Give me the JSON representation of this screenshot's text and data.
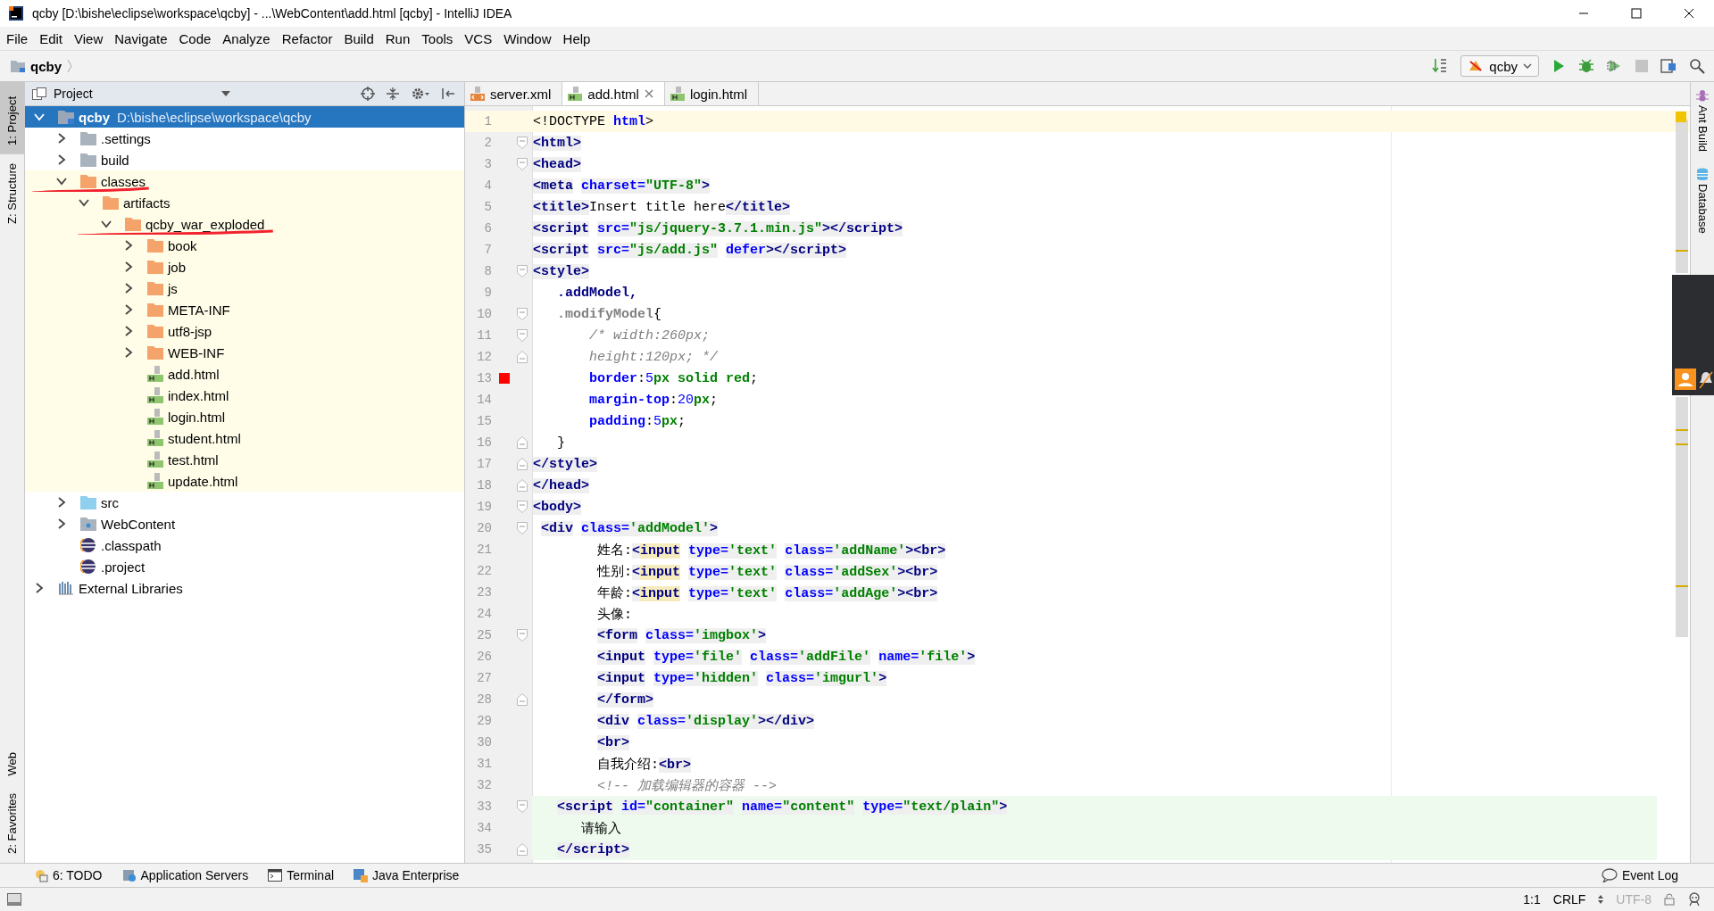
{
  "window": {
    "title": "qcby [D:\\bishe\\eclipse\\workspace\\qcby] - ...\\WebContent\\add.html [qcby] - IntelliJ IDEA"
  },
  "menu": [
    "File",
    "Edit",
    "View",
    "Navigate",
    "Code",
    "Analyze",
    "Refactor",
    "Build",
    "Run",
    "Tools",
    "VCS",
    "Window",
    "Help"
  ],
  "navbar": {
    "crumb": "qcby",
    "run_config": "qcby"
  },
  "left_stripe": {
    "top": [
      {
        "label": "1: Project",
        "selected": true
      },
      {
        "label": "Z: Structure",
        "selected": false
      }
    ],
    "bottom": [
      {
        "label": "Web",
        "selected": false
      },
      {
        "label": "2: Favorites",
        "selected": false
      }
    ]
  },
  "right_stripe": [
    {
      "label": "Ant Build",
      "kind": "ant"
    },
    {
      "label": "Database",
      "kind": "db"
    }
  ],
  "project": {
    "title": "Project",
    "tree": [
      {
        "name": "qcby",
        "path": "D:\\bishe\\eclipse\\workspace\\qcby",
        "kind": "module",
        "expanded": true,
        "selected": true,
        "children": [
          {
            "name": ".settings",
            "kind": "folder",
            "expanded": false,
            "selected": false,
            "excluded": false,
            "annotated": false
          },
          {
            "name": "build",
            "kind": "folder",
            "expanded": false,
            "selected": false,
            "excluded": false,
            "annotated": false
          },
          {
            "name": "classes",
            "kind": "folder-excluded",
            "expanded": true,
            "selected": false,
            "excluded": true,
            "annotated": true,
            "children": [
              {
                "name": "artifacts",
                "kind": "folder-excluded",
                "expanded": true,
                "selected": false,
                "children": [
                  {
                    "name": "qcby_war_exploded",
                    "kind": "folder-excluded",
                    "expanded": true,
                    "selected": false,
                    "annotated": true,
                    "children": [
                      {
                        "name": "book",
                        "kind": "folder-excluded",
                        "expanded": false,
                        "selected": false
                      },
                      {
                        "name": "job",
                        "kind": "folder-excluded",
                        "expanded": false,
                        "selected": false
                      },
                      {
                        "name": "js",
                        "kind": "folder-excluded",
                        "expanded": false,
                        "selected": false
                      },
                      {
                        "name": "META-INF",
                        "kind": "folder-excluded",
                        "expanded": false,
                        "selected": false
                      },
                      {
                        "name": "utf8-jsp",
                        "kind": "folder-excluded",
                        "expanded": false,
                        "selected": false
                      },
                      {
                        "name": "WEB-INF",
                        "kind": "folder-excluded",
                        "expanded": false,
                        "selected": false
                      },
                      {
                        "name": "add.html",
                        "kind": "html",
                        "selected": false
                      },
                      {
                        "name": "index.html",
                        "kind": "html",
                        "selected": false
                      },
                      {
                        "name": "login.html",
                        "kind": "html",
                        "selected": false
                      },
                      {
                        "name": "student.html",
                        "kind": "html",
                        "selected": false
                      },
                      {
                        "name": "test.html",
                        "kind": "html",
                        "selected": false
                      },
                      {
                        "name": "update.html",
                        "kind": "html",
                        "selected": false
                      }
                    ]
                  }
                ]
              }
            ]
          },
          {
            "name": "src",
            "kind": "folder-source",
            "expanded": false,
            "selected": false,
            "excluded": false,
            "annotated": false
          },
          {
            "name": "WebContent",
            "kind": "folder-web",
            "expanded": false,
            "selected": false,
            "excluded": false,
            "annotated": false
          },
          {
            "name": ".classpath",
            "kind": "eclipse",
            "selected": false,
            "excluded": false,
            "annotated": false
          },
          {
            "name": ".project",
            "kind": "eclipse",
            "selected": false,
            "excluded": false,
            "annotated": false
          }
        ]
      },
      {
        "name": "External Libraries",
        "kind": "library",
        "expanded": false,
        "selected": false
      }
    ]
  },
  "tabs": [
    {
      "label": "server.xml",
      "kind": "xml",
      "selected": false
    },
    {
      "label": "add.html",
      "kind": "html",
      "selected": true
    },
    {
      "label": "login.html",
      "kind": "html",
      "selected": false
    }
  ],
  "editor": {
    "lines": [
      {
        "num": "1",
        "current": true,
        "tokens": [
          {
            "kind": "text",
            "text": "<!DOCTYPE "
          },
          {
            "kind": "keyword",
            "text": "html"
          },
          {
            "kind": "text",
            "text": ">"
          }
        ]
      },
      {
        "num": "2",
        "fold_start": true,
        "tokens": [
          {
            "kind": "tag",
            "text": "<html>"
          }
        ]
      },
      {
        "num": "3",
        "fold_start": true,
        "tokens": [
          {
            "kind": "tag",
            "text": "<head>"
          }
        ]
      },
      {
        "num": "4",
        "tokens": [
          {
            "kind": "tag",
            "text": "<meta"
          },
          {
            "kind": "attr",
            "text": " charset="
          },
          {
            "kind": "value",
            "text": "\"UTF-8\""
          },
          {
            "kind": "tag",
            "text": ">"
          }
        ]
      },
      {
        "num": "5",
        "tokens": [
          {
            "kind": "tag",
            "text": "<title>"
          },
          {
            "kind": "text",
            "text": "Insert title here"
          },
          {
            "kind": "tag",
            "text": "</title>"
          }
        ]
      },
      {
        "num": "6",
        "tokens": [
          {
            "kind": "tag",
            "text": "<script"
          },
          {
            "kind": "attr",
            "text": " src="
          },
          {
            "kind": "value",
            "text": "\"js/jquery-3.7.1.min.js\""
          },
          {
            "kind": "tag",
            "text": "></script>"
          }
        ]
      },
      {
        "num": "7",
        "tokens": [
          {
            "kind": "tag",
            "text": "<script"
          },
          {
            "kind": "attr",
            "text": " src="
          },
          {
            "kind": "value",
            "text": "\"js/add.js\""
          },
          {
            "kind": "attr",
            "text": " defer"
          },
          {
            "kind": "tag",
            "text": "></script>"
          }
        ]
      },
      {
        "num": "8",
        "fold_start": true,
        "tokens": [
          {
            "kind": "tag",
            "text": "<style>"
          }
        ]
      },
      {
        "num": "9",
        "tokens": [
          {
            "kind": "selector",
            "text": "   .addModel,"
          }
        ]
      },
      {
        "num": "10",
        "fold_start": true,
        "tokens": [
          {
            "kind": "unused",
            "text": "   .modifyModel"
          },
          {
            "kind": "text",
            "text": "{"
          }
        ]
      },
      {
        "num": "11",
        "fold_start": true,
        "tokens": [
          {
            "kind": "comment",
            "text": "       /* width:260px;"
          }
        ]
      },
      {
        "num": "12",
        "fold_end": true,
        "tokens": [
          {
            "kind": "comment",
            "text": "       height:120px; */"
          }
        ]
      },
      {
        "num": "13",
        "color": "#ff0000",
        "tokens": [
          {
            "kind": "property",
            "text": "       border"
          },
          {
            "kind": "text",
            "text": ":"
          },
          {
            "kind": "number",
            "text": "5"
          },
          {
            "kind": "cssvalue",
            "text": "px solid red"
          },
          {
            "kind": "text",
            "text": ";"
          }
        ]
      },
      {
        "num": "14",
        "tokens": [
          {
            "kind": "property",
            "text": "       margin-top"
          },
          {
            "kind": "text",
            "text": ":"
          },
          {
            "kind": "number",
            "text": "20"
          },
          {
            "kind": "cssvalue",
            "text": "px"
          },
          {
            "kind": "text",
            "text": ";"
          }
        ]
      },
      {
        "num": "15",
        "tokens": [
          {
            "kind": "property",
            "text": "       padding"
          },
          {
            "kind": "text",
            "text": ":"
          },
          {
            "kind": "number",
            "text": "5"
          },
          {
            "kind": "cssvalue",
            "text": "px"
          },
          {
            "kind": "text",
            "text": ";"
          }
        ]
      },
      {
        "num": "16",
        "fold_end": true,
        "tokens": [
          {
            "kind": "text",
            "text": "   }"
          }
        ]
      },
      {
        "num": "17",
        "fold_end": true,
        "tokens": [
          {
            "kind": "tag",
            "text": "</style>"
          }
        ]
      },
      {
        "num": "18",
        "fold_end": true,
        "tokens": [
          {
            "kind": "tag",
            "text": "</head>"
          }
        ]
      },
      {
        "num": "19",
        "fold_start": true,
        "tokens": [
          {
            "kind": "tag",
            "text": "<body>"
          }
        ]
      },
      {
        "num": "20",
        "fold_start": true,
        "tokens": [
          {
            "kind": "tag",
            "text": " <div"
          },
          {
            "kind": "attr",
            "text": " class="
          },
          {
            "kind": "value",
            "text": "'addModel'"
          },
          {
            "kind": "tag",
            "text": ">"
          }
        ]
      },
      {
        "num": "21",
        "tokens": [
          {
            "kind": "text",
            "text": "        姓名:"
          },
          {
            "kind": "tag",
            "text": "<"
          },
          {
            "kind": "match",
            "text": "input"
          },
          {
            "kind": "attr",
            "text": " type="
          },
          {
            "kind": "value",
            "text": "'text'"
          },
          {
            "kind": "attr",
            "text": " class="
          },
          {
            "kind": "value",
            "text": "'addName'"
          },
          {
            "kind": "tag",
            "text": "><br>"
          }
        ]
      },
      {
        "num": "22",
        "tokens": [
          {
            "kind": "text",
            "text": "        性别:"
          },
          {
            "kind": "tag",
            "text": "<"
          },
          {
            "kind": "match",
            "text": "input"
          },
          {
            "kind": "attr",
            "text": " type="
          },
          {
            "kind": "value",
            "text": "'text'"
          },
          {
            "kind": "attr",
            "text": " class="
          },
          {
            "kind": "value",
            "text": "'addSex'"
          },
          {
            "kind": "tag",
            "text": "><br>"
          }
        ]
      },
      {
        "num": "23",
        "tokens": [
          {
            "kind": "text",
            "text": "        年龄:"
          },
          {
            "kind": "tag",
            "text": "<"
          },
          {
            "kind": "match",
            "text": "input"
          },
          {
            "kind": "attr",
            "text": " type="
          },
          {
            "kind": "value",
            "text": "'text'"
          },
          {
            "kind": "attr",
            "text": " class="
          },
          {
            "kind": "value",
            "text": "'addAge'"
          },
          {
            "kind": "tag",
            "text": "><br>"
          }
        ]
      },
      {
        "num": "24",
        "tokens": [
          {
            "kind": "text",
            "text": "        头像:"
          }
        ]
      },
      {
        "num": "25",
        "fold_start": true,
        "tokens": [
          {
            "kind": "tag",
            "text": "        <form"
          },
          {
            "kind": "attr",
            "text": " class="
          },
          {
            "kind": "value",
            "text": "'imgbox'"
          },
          {
            "kind": "tag",
            "text": ">"
          }
        ]
      },
      {
        "num": "26",
        "tokens": [
          {
            "kind": "tag",
            "text": "        <input"
          },
          {
            "kind": "attr",
            "text": " type="
          },
          {
            "kind": "value",
            "text": "'file'"
          },
          {
            "kind": "attr",
            "text": " class="
          },
          {
            "kind": "value",
            "text": "'addFile'"
          },
          {
            "kind": "attr",
            "text": " name="
          },
          {
            "kind": "value",
            "text": "'file'"
          },
          {
            "kind": "tag",
            "text": ">"
          }
        ]
      },
      {
        "num": "27",
        "tokens": [
          {
            "kind": "tag",
            "text": "        <input"
          },
          {
            "kind": "attr",
            "text": " type="
          },
          {
            "kind": "value",
            "text": "'hidden'"
          },
          {
            "kind": "attr",
            "text": " class="
          },
          {
            "kind": "value",
            "text": "'imgurl'"
          },
          {
            "kind": "tag",
            "text": ">"
          }
        ]
      },
      {
        "num": "28",
        "fold_end": true,
        "tokens": [
          {
            "kind": "tag",
            "text": "        </form>"
          }
        ]
      },
      {
        "num": "29",
        "tokens": [
          {
            "kind": "tag",
            "text": "        <div"
          },
          {
            "kind": "attr",
            "text": " class="
          },
          {
            "kind": "value",
            "text": "'display'"
          },
          {
            "kind": "tag",
            "text": "></div>"
          }
        ]
      },
      {
        "num": "30",
        "tokens": [
          {
            "kind": "tag",
            "text": "        <br>"
          }
        ]
      },
      {
        "num": "31",
        "tokens": [
          {
            "kind": "text",
            "text": "        自我介绍:"
          },
          {
            "kind": "tag",
            "text": "<br>"
          }
        ]
      },
      {
        "num": "32",
        "tokens": [
          {
            "kind": "comment",
            "text": "        <!-- 加载编辑器的容器 -->"
          }
        ]
      },
      {
        "num": "33",
        "fold_start": true,
        "injected": true,
        "tokens": [
          {
            "kind": "tag",
            "text": "   <script"
          },
          {
            "kind": "attr",
            "text": " id="
          },
          {
            "kind": "value",
            "text": "\"container\""
          },
          {
            "kind": "attr",
            "text": " name="
          },
          {
            "kind": "value",
            "text": "\"content\""
          },
          {
            "kind": "attr",
            "text": " type="
          },
          {
            "kind": "value",
            "text": "\"text/plain\""
          },
          {
            "kind": "tag",
            "text": ">"
          }
        ]
      },
      {
        "num": "34",
        "injected": true,
        "tokens": [
          {
            "kind": "text",
            "text": "      请输入"
          }
        ]
      },
      {
        "num": "35",
        "fold_end": true,
        "injected": true,
        "tokens": [
          {
            "kind": "tag",
            "text": "   </script>"
          }
        ]
      }
    ]
  },
  "bottom_tools": [
    "6: TODO",
    "Application Servers",
    "Terminal",
    "Java Enterprise"
  ],
  "event_log": "Event Log",
  "status_bar": {
    "position": "1:1",
    "line_separator": "CRLF",
    "encoding": "UTF-8",
    "encoding_disabled": true
  }
}
